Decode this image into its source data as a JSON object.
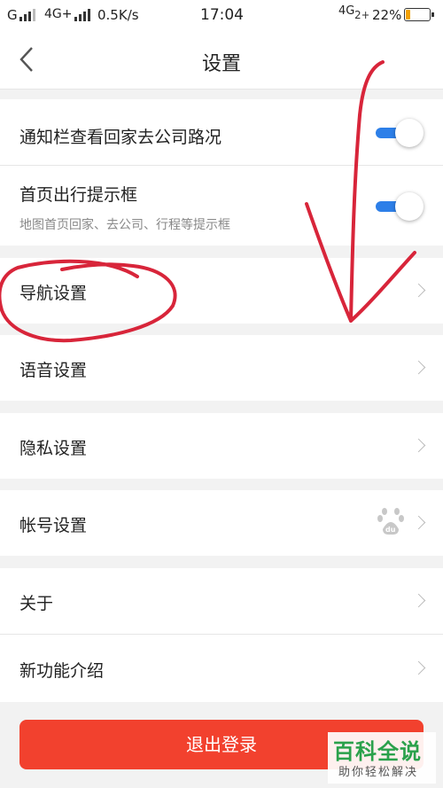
{
  "status_bar": {
    "carrier1": "G",
    "carrier2": "4G+",
    "speed": "0.5K/s",
    "time": "17:04",
    "network": "4G",
    "battery_text": "22%",
    "battery_level": 0.22
  },
  "header": {
    "title": "设置"
  },
  "rows": {
    "notify": {
      "label": "通知栏查看回家去公司路况",
      "enabled": true
    },
    "home_tip": {
      "label": "首页出行提示框",
      "sub": "地图首页回家、去公司、行程等提示框",
      "enabled": true
    },
    "navigation": {
      "label": "导航设置"
    },
    "voice": {
      "label": "语音设置"
    },
    "privacy": {
      "label": "隐私设置"
    },
    "account": {
      "label": "帐号设置",
      "badge_icon": "baidu-paw-icon"
    },
    "about": {
      "label": "关于"
    },
    "new_features": {
      "label": "新功能介绍"
    }
  },
  "logout_label": "退出登录",
  "watermark": {
    "title": "百科全说",
    "subtitle": "助你轻松解决"
  },
  "colors": {
    "accent": "#2d7fe8",
    "logout": "#f2412e",
    "annotation": "#d8253a",
    "watermark": "#2aa14b"
  }
}
